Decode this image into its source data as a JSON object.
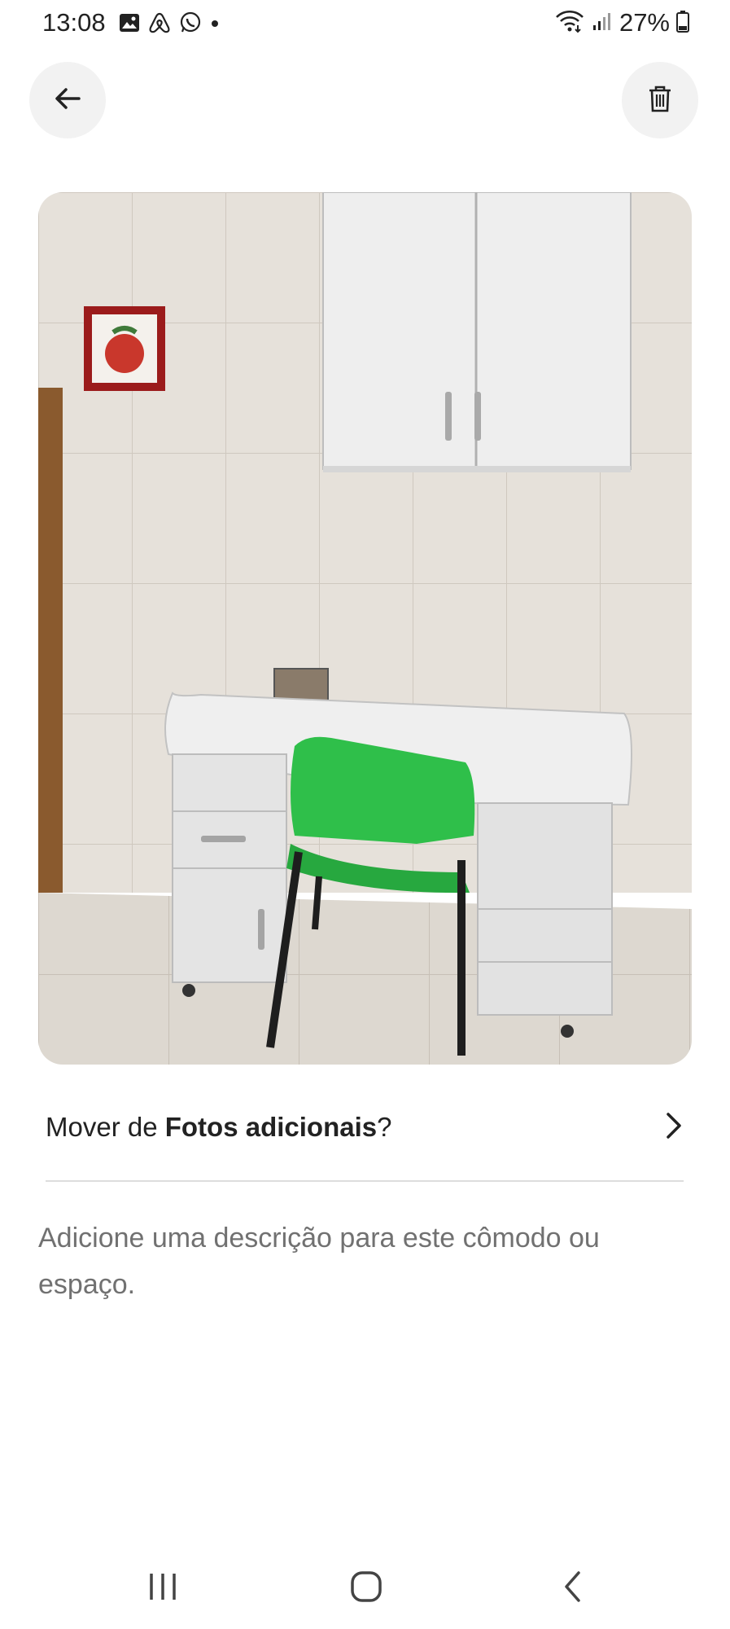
{
  "status_bar": {
    "time": "13:08",
    "battery": "27%",
    "icons_left": [
      "gallery-icon",
      "airbnb-icon",
      "whatsapp-icon",
      "dot-icon"
    ],
    "icons_right": [
      "wifi-icon",
      "signal-icon",
      "battery-icon"
    ]
  },
  "header": {
    "back_icon": "arrow-left-icon",
    "delete_icon": "trash-icon"
  },
  "photo": {
    "subject": "room-photo"
  },
  "move": {
    "prefix": "Mover de ",
    "album": "Fotos adicionais",
    "suffix": "?",
    "icon": "chevron-right-icon"
  },
  "description": {
    "placeholder": "Adicione uma descrição para este cômodo ou espaço."
  },
  "nav": {
    "recent_icon": "recent-apps-icon",
    "home_icon": "home-icon",
    "back_icon": "back-chevron-icon"
  },
  "colors": {
    "text": "#222222",
    "muted": "#717171",
    "button_bg": "#f2f2f2",
    "divider": "#dddddd"
  }
}
